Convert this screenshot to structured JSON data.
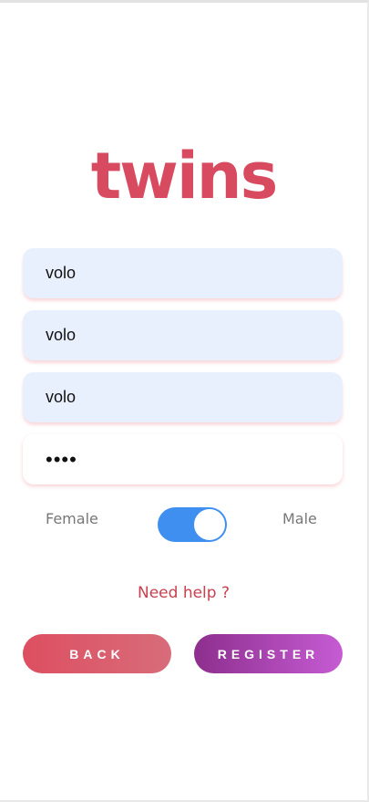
{
  "app": {
    "logo": "twins"
  },
  "form": {
    "field1": {
      "value": "volo"
    },
    "field2": {
      "value": "volo"
    },
    "field3": {
      "value": "volo"
    },
    "password": {
      "value": "••••"
    }
  },
  "gender": {
    "female_label": "Female",
    "male_label": "Male",
    "selected": "Male"
  },
  "help": {
    "text": "Need help ?"
  },
  "buttons": {
    "back": "BACK",
    "register": "REGISTER"
  },
  "colors": {
    "brand": "#d84a5f",
    "toggle": "#3f8ff0",
    "back_gradient": [
      "#dd4f61",
      "#d86c7a"
    ],
    "register_gradient": [
      "#8d2f8e",
      "#c65bd3"
    ]
  }
}
